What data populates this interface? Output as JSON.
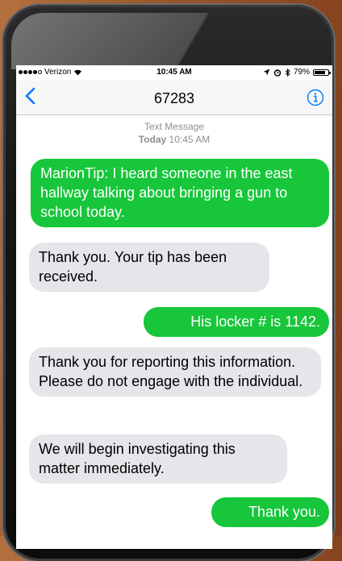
{
  "status_bar": {
    "carrier": "Verizon",
    "time": "10:45 AM",
    "battery_text": "79%",
    "battery_level": 0.79
  },
  "nav": {
    "title": "67283"
  },
  "thread_meta": {
    "label": "Text Message",
    "day": "Today",
    "time": "10:45 AM"
  },
  "messages": [
    {
      "direction": "sent",
      "text": "MarionTip: I heard someone in the east hallway talking about bringing a gun to school today."
    },
    {
      "direction": "received",
      "text": "Thank you. Your tip has been received."
    },
    {
      "direction": "sent",
      "text": "His locker # is 1142."
    },
    {
      "direction": "received",
      "text": "Thank you for reporting this information. Please do not engage with the individual."
    },
    {
      "direction": "received",
      "text": "We will begin investigating this matter immediately."
    },
    {
      "direction": "sent",
      "text": "Thank you."
    }
  ],
  "colors": {
    "sent_bubble": "#17c63a",
    "received_bubble": "#e5e5ea",
    "accent": "#007aff"
  }
}
